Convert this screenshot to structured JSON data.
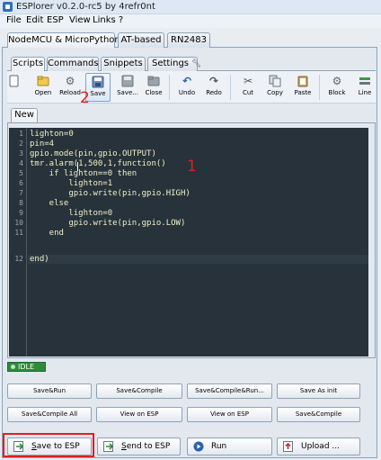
{
  "window": {
    "title": "ESPlorer v0.2.0-rc5 by 4refr0nt"
  },
  "menu": [
    "File",
    "Edit",
    "ESP",
    "View",
    "Links ?"
  ],
  "top_tabs": [
    "NodeMCU & MicroPython",
    "AT-based",
    "RN2483"
  ],
  "sub_tabs": [
    "Scripts",
    "Commands",
    "Snippets",
    "Settings"
  ],
  "toolbar": [
    "Open",
    "Reload",
    "Save",
    "Save...",
    "Close",
    "Undo",
    "Redo",
    "Cut",
    "Copy",
    "Paste",
    "Block",
    "Line"
  ],
  "file_tab": "New",
  "editor": {
    "line_numbers": [
      "1",
      "2",
      "3",
      "4",
      "5",
      "6",
      "7",
      "8",
      "9",
      "10",
      "11",
      "12"
    ],
    "lines": [
      "lighton=0",
      "pin=4",
      "gpio.mode(pin,gpio.OUTPUT)",
      "tmr.alarm(1,500,1,function()",
      "    if lighton==0 then",
      "        lighton=1",
      "        gpio.write(pin,gpio.HIGH)",
      "    else",
      "        lighton=0",
      "        gpio.write(pin,gpio.LOW)",
      "    end",
      "end)"
    ]
  },
  "annotations": {
    "mark_1": "1",
    "mark_2": "2"
  },
  "status": {
    "idle": "IDLE"
  },
  "buttons_row1": [
    "Save&Run",
    "Save&Compile",
    "Save&Compile&Run...",
    "Save As init"
  ],
  "buttons_row2": [
    "Save&Compile All",
    "View on ESP",
    "View on ESP",
    "Save&Compile"
  ],
  "big_buttons": {
    "save_to_esp": {
      "first": "S",
      "rest": "ave to ESP"
    },
    "send_to_esp": {
      "first": "S",
      "rest": "end to ESP"
    },
    "run": "Run",
    "upload": "Upload ..."
  },
  "colors": {
    "editor_bg": "#27323a",
    "code_text": "#f0f0c8",
    "idle_green": "#2e8b3a",
    "annotation_red": "#e02020"
  }
}
